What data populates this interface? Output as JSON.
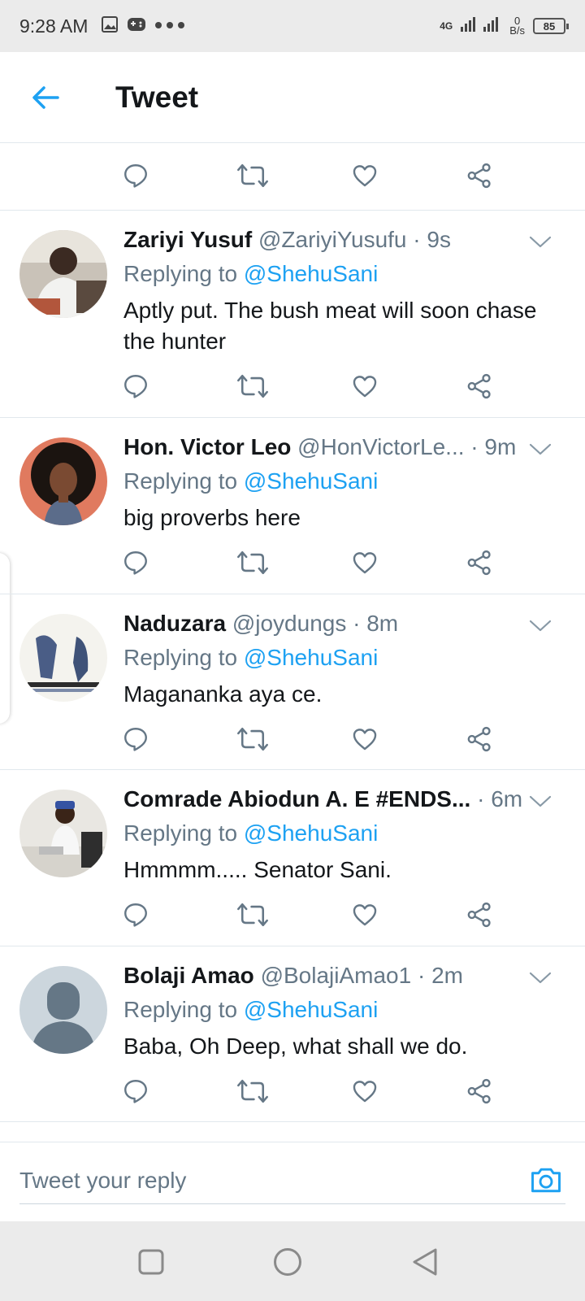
{
  "status_bar": {
    "time": "9:28 AM",
    "network": "4G",
    "data_rate_value": "0",
    "data_rate_unit": "B/s",
    "battery": "85"
  },
  "header": {
    "title": "Tweet"
  },
  "replies": [
    {
      "name": "Zariyi Yusuf",
      "handle": "@ZariyiYusufu",
      "time": "· 9s",
      "replying_prefix": "Replying to ",
      "mention": "@ShehuSani",
      "text": "Aptly put. The bush meat will soon chase the hunter"
    },
    {
      "name": "Hon. Victor Leo",
      "handle": "@HonVictorLe...",
      "time": "· 9m",
      "replying_prefix": "Replying to ",
      "mention": "@ShehuSani",
      "text": "big proverbs here"
    },
    {
      "name": "Naduzara",
      "handle": "@joydungs",
      "time": "· 8m",
      "replying_prefix": "Replying to ",
      "mention": "@ShehuSani",
      "text": "Magananka aya ce."
    },
    {
      "name": "Comrade Abiodun A. E #ENDS...",
      "handle": "",
      "time": "· 6m",
      "replying_prefix": "Replying to ",
      "mention": "@ShehuSani",
      "text": "Hmmmm..... Senator Sani."
    },
    {
      "name": "Bolaji Amao",
      "handle": "@BolajiAmao1",
      "time": "· 2m",
      "replying_prefix": "Replying to ",
      "mention": "@ShehuSani",
      "text": "Baba, Oh Deep, what shall we do."
    }
  ],
  "reply_bar": {
    "placeholder": "Tweet your reply"
  },
  "colors": {
    "accent": "#1da1f2",
    "secondary_text": "#657786",
    "divider": "#e1e8ed"
  }
}
